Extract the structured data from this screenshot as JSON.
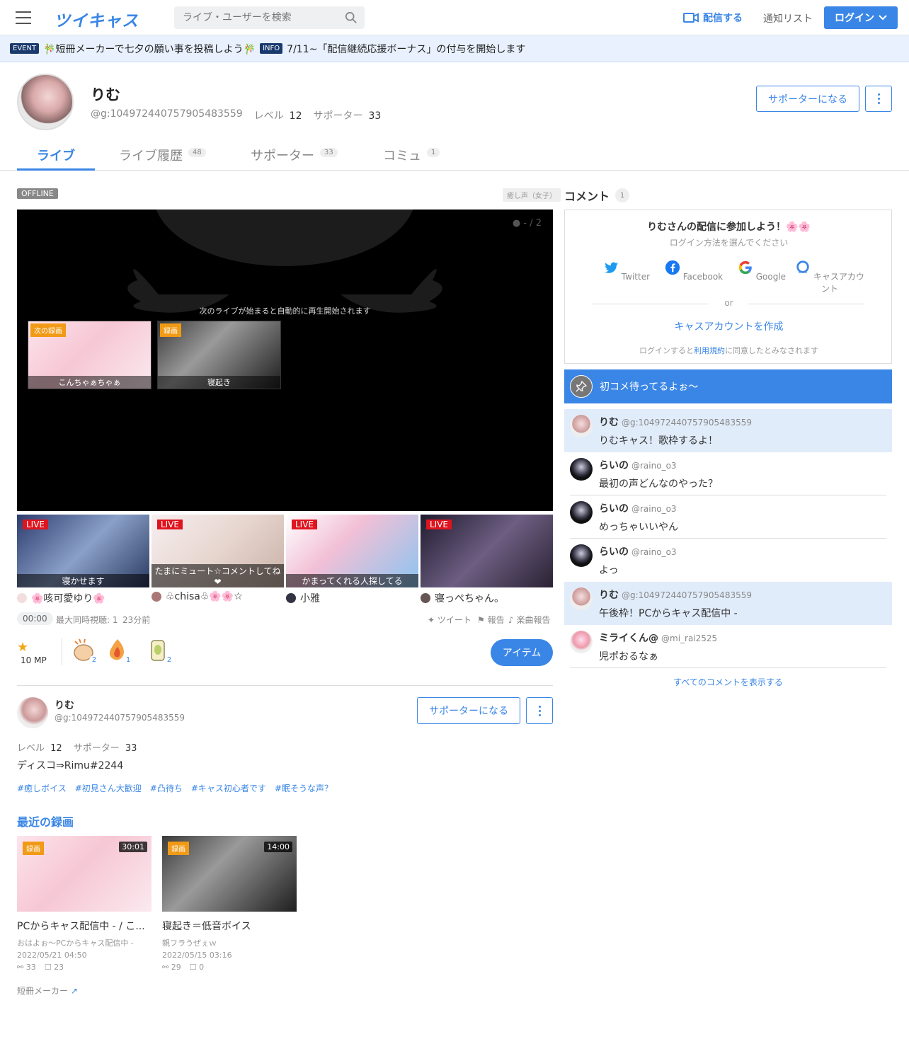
{
  "header": {
    "logo": "ツイキャス",
    "search_placeholder": "ライブ・ユーザーを検索",
    "broadcast_label": "配信する",
    "notify_label": "通知リスト",
    "login_label": "ログイン"
  },
  "notice": {
    "event_badge": "EVENT",
    "event_text": "🎋短冊メーカーで七夕の願い事を投稿しよう🎋",
    "info_badge": "INFO",
    "info_text": "7/11~「配信継続応援ボーナス」の付与を開始します"
  },
  "profile": {
    "name": "りむ",
    "handle": "@g:104972440757905483559",
    "level_label": "レベル",
    "level": "12",
    "supporter_label": "サポーター",
    "supporters": "33",
    "become_supporter": "サポーターになる"
  },
  "tabs": [
    {
      "label": "ライブ",
      "count": ""
    },
    {
      "label": "ライブ履歴",
      "count": "48"
    },
    {
      "label": "サポーター",
      "count": "33"
    },
    {
      "label": "コミュ",
      "count": "1"
    }
  ],
  "player": {
    "status": "OFFLINE",
    "category": "癒し声（女子）",
    "viewers": "- / 2",
    "message": "次のライブが始まると自動的に再生開始されます",
    "thumbs": [
      {
        "tag": "次の録画",
        "caption": "こんちゃぁちゃぁ"
      },
      {
        "tag": "録画",
        "caption": "寝起き"
      }
    ]
  },
  "live_cards": [
    {
      "badge": "LIVE",
      "caption": "寝かせます",
      "user": "🌸咳可愛ゆり🌸"
    },
    {
      "badge": "LIVE",
      "caption": "たまにミュート☆コメントしてね❤",
      "user": "♧chisa♧🌸🌸☆"
    },
    {
      "badge": "LIVE",
      "caption": "かまってくれる人探してる",
      "user": "小雅"
    },
    {
      "badge": "LIVE",
      "caption": "",
      "user": "寝っぺちゃん。"
    }
  ],
  "stats": {
    "duration": "00:00",
    "max_viewers": "最大同時視聴: 1",
    "ago": "23分前",
    "tweet": "ツイート",
    "report": "報告",
    "music_report": "楽曲報告"
  },
  "mp": {
    "value": "10 MP"
  },
  "gifts": [
    {
      "icon": "clap-icon",
      "count": "2"
    },
    {
      "icon": "flame-icon",
      "count": "1"
    },
    {
      "icon": "tea-icon",
      "count": "2"
    }
  ],
  "item_button": "アイテム",
  "bio": {
    "name": "りむ",
    "handle": "@g:104972440757905483559",
    "level_label": "レベル",
    "level": "12",
    "supporter_label": "サポーター",
    "supporters": "33",
    "text": "ディスコ⇒Rimu#2244",
    "hashtags": [
      "#癒しボイス",
      "#初見さん大歓迎",
      "#凸待ち",
      "#キャス初心者です",
      "#眠そうな声？"
    ]
  },
  "recent": {
    "title": "最近の録画",
    "items": [
      {
        "tag": "録画",
        "duration": "30:01",
        "title": "PCからキャス配信中 - / こ...",
        "sub": "おはよぉ～PCからキャス配信中 -",
        "date": "2022/05/21 04:50",
        "views": "33",
        "comments": "23"
      },
      {
        "tag": "録画",
        "duration": "14:00",
        "title": "寝起き＝低音ボイス",
        "sub": "親フラうぜぇｗ",
        "date": "2022/05/15 03:16",
        "views": "29",
        "comments": "0"
      }
    ]
  },
  "tanzaku_link": "短冊メーカー",
  "comments_panel": {
    "title": "コメント",
    "count": "1",
    "login_title": "りむさんの配信に参加しよう！🌸🌸",
    "login_sub": "ログイン方法を選んでください",
    "providers": [
      "Twitter",
      "Facebook",
      "Google",
      "キャスアカウント"
    ],
    "or": "or",
    "create": "キャスアカウントを作成",
    "terms_pre": "ログインすると",
    "terms_link": "利用規約",
    "terms_post": "に同意したとみなされます",
    "pinned": "初コメ待ってるよぉ～",
    "show_all": "すべてのコメントを表示する"
  },
  "comments": [
    {
      "name": "りむ",
      "handle": "@g:104972440757905483559",
      "text": "りむキャス！歌枠するよ！"
    },
    {
      "name": "らいの",
      "handle": "@raino_o3",
      "text": "最初の声どんなのやった？"
    },
    {
      "name": "らいの",
      "handle": "@raino_o3",
      "text": "めっちゃいいやん"
    },
    {
      "name": "らいの",
      "handle": "@raino_o3",
      "text": "よっ"
    },
    {
      "name": "りむ",
      "handle": "@g:104972440757905483559",
      "text": "午後枠！PCからキャス配信中 -"
    },
    {
      "name": "ミライくん@",
      "handle": "@mi_rai2525",
      "text": "児ポおるなぁ"
    }
  ],
  "colors": {
    "accent": "#3a86e6",
    "live": "#e0141e",
    "record": "#f19a16"
  }
}
